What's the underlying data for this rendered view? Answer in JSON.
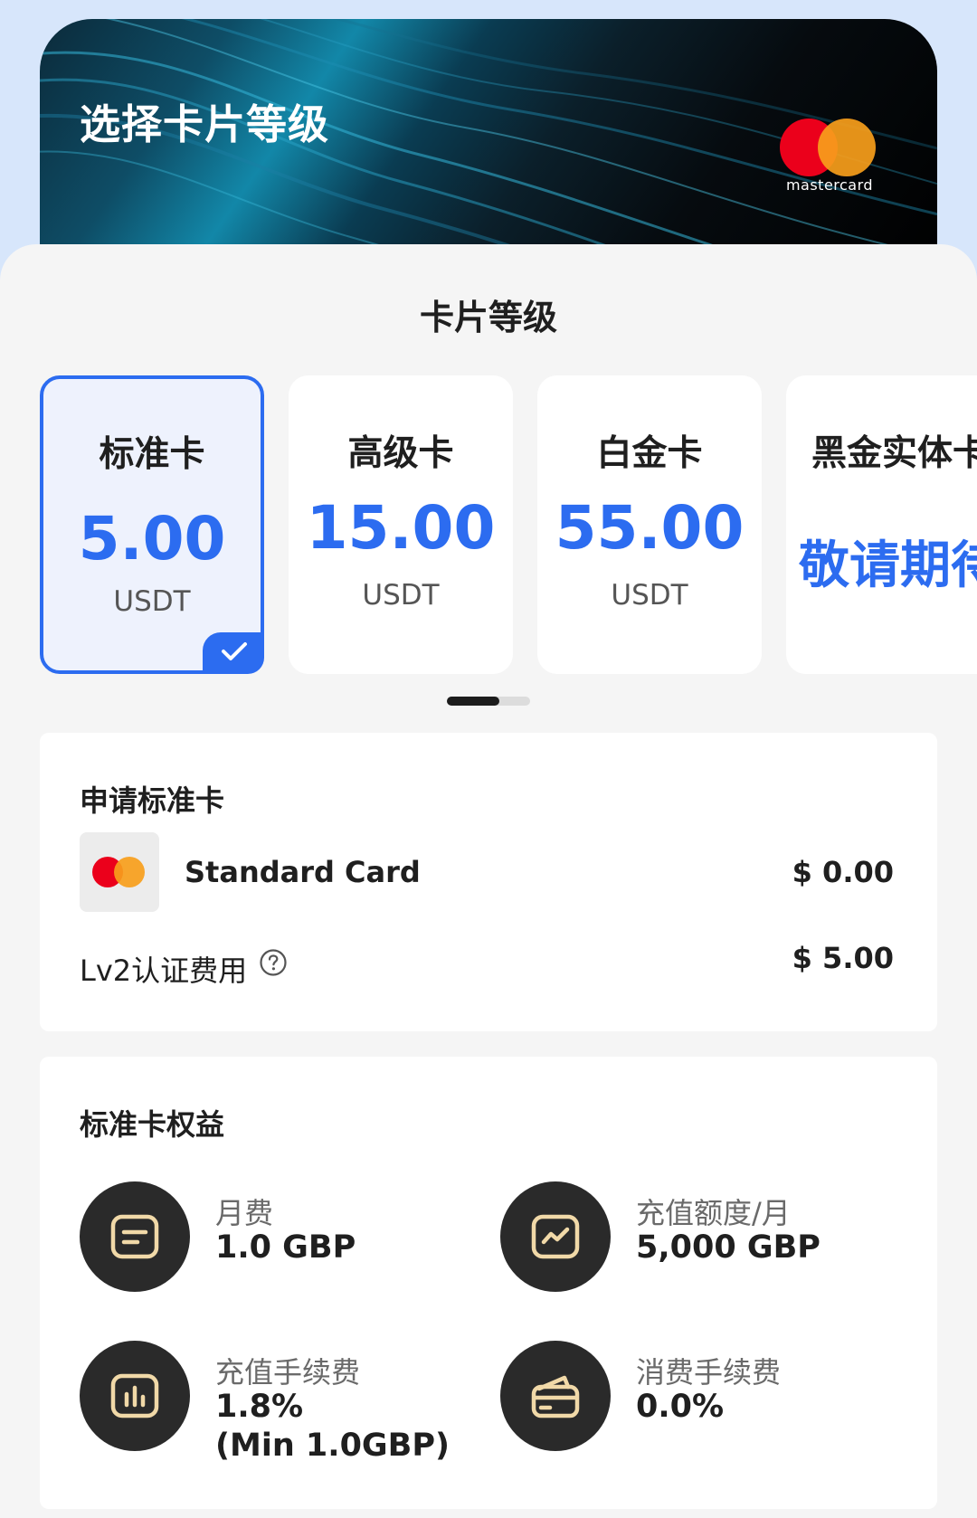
{
  "hero": {
    "title": "选择卡片等级",
    "brand_text": "mastercard"
  },
  "tiers_section": {
    "title": "卡片等级",
    "tiers": [
      {
        "name": "标准卡",
        "price": "5.00",
        "unit": "USDT",
        "selected": true
      },
      {
        "name": "高级卡",
        "price": "15.00",
        "unit": "USDT",
        "selected": false
      },
      {
        "name": "白金卡",
        "price": "55.00",
        "unit": "USDT",
        "selected": false
      },
      {
        "name": "黑金实体卡",
        "status": "敬请期待",
        "selected": false
      }
    ],
    "pager": {
      "active_index": 0,
      "page_count": 2
    }
  },
  "apply": {
    "title": "申请标准卡",
    "card_name": "Standard Card",
    "card_price": "$ 0.00",
    "fee_label": "Lv2认证费用",
    "fee_price": "$ 5.00"
  },
  "benefits": {
    "title": "标准卡权益",
    "items": [
      {
        "label": "月费",
        "value": "1.0 GBP",
        "icon": "document-icon"
      },
      {
        "label": "充值额度/月",
        "value": "5,000 GBP",
        "icon": "trend-chart-icon"
      },
      {
        "label": "充值手续费",
        "value": "1.8%",
        "value2": "(Min 1.0GBP)",
        "icon": "bar-chart-icon"
      },
      {
        "label": "消费手续费",
        "value": "0.0%",
        "icon": "wallet-card-icon"
      }
    ]
  },
  "colors": {
    "accent": "#2c6cf0",
    "page_bg": "#d7e6fb",
    "icon_bg": "#2a2a2a",
    "icon_stroke": "#f1d9a8",
    "mastercard_red": "#eb001b",
    "mastercard_orange": "#f79e1b"
  }
}
